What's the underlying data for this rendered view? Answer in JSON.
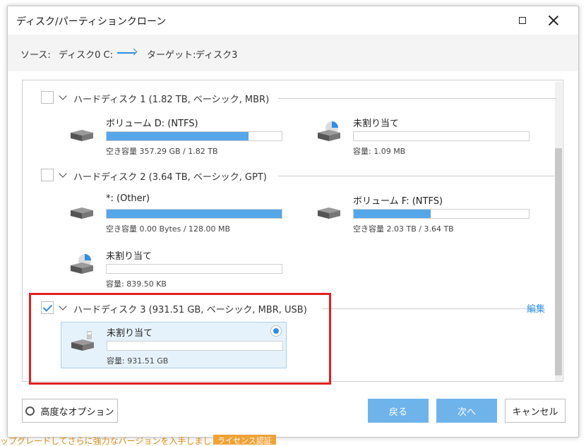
{
  "window": {
    "title": "ディスク/パーティションクローン"
  },
  "source_bar": {
    "source_label": "ソース:",
    "source_value": "ディスク0 C:",
    "target_label": "ターゲット:",
    "target_value": "ディスク3"
  },
  "disks": [
    {
      "checked": false,
      "label": "ハードディスク 1 (1.82 TB, ベーシック, MBR)",
      "partitions": [
        {
          "name": "ボリューム D: (NTFS)",
          "info": "空き容量 357.29 GB / 1.82 TB",
          "usage": 0.81,
          "icon": "hdd-icon"
        },
        {
          "name": "未割り当て",
          "info": "容量: 1.09 MB",
          "usage": 0.0,
          "icon": "unallocated-pie-icon"
        }
      ]
    },
    {
      "checked": false,
      "label": "ハードディスク 2 (3.64 TB, ベーシック, GPT)",
      "partitions": [
        {
          "name": "*: (Other)",
          "info": "空き容量 0.00 Bytes / 128.00 MB",
          "usage": 1.0,
          "icon": "hdd-icon"
        },
        {
          "name": "ボリューム F: (NTFS)",
          "info": "空き容量 2.03 TB / 3.64 TB",
          "usage": 0.44,
          "icon": "hdd-icon"
        },
        {
          "name": "未割り当て",
          "info": "容量: 839.50 KB",
          "usage": 0.0,
          "icon": "unallocated-pie-icon"
        }
      ]
    },
    {
      "checked": true,
      "label": "ハードディスク 3 (931.51 GB, ベーシック, MBR, USB)",
      "edit_label": "編集",
      "partitions": [
        {
          "name": "未割り当て",
          "info": "容量: 931.51 GB",
          "usage": 0.0,
          "icon": "usb-drive-icon",
          "selected": true
        }
      ]
    }
  ],
  "footer": {
    "advanced_label": "高度なオプション",
    "back_label": "戻る",
    "next_label": "次へ",
    "cancel_label": "キャンセル"
  },
  "promo": {
    "text": "ップグレードしてさらに強力なバージョンを入手しましょう。",
    "badge": "ライセンス認証"
  },
  "colors": {
    "accent": "#2f8ee0",
    "bar_fill": "#56a6ea",
    "highlight": "#e0201f",
    "button_primary": "#6fb3eb"
  }
}
